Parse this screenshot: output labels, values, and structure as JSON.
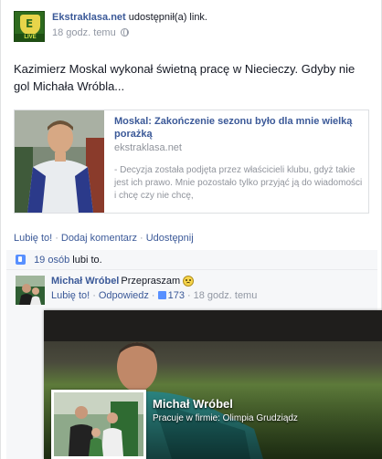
{
  "post": {
    "page_name": "Ekstraklasa.net",
    "action": "udostępnił(a) link.",
    "timestamp": "18 godz. temu",
    "logo_letter": "E",
    "logo_band": "LIVE",
    "message": "Kazimierz Moskal wykonał świetną pracę w Niecieczy. Gdyby nie gol Michała Wróbla..."
  },
  "attachment": {
    "title": "Moskal: Zakończenie sezonu było dla mnie wielką porażką",
    "source": "ekstraklasa.net",
    "description": "- Decyzja została podjęta przez właścicieli klubu, gdyż takie jest ich prawo. Mnie pozostało tylko przyjąć ją do wiadomości i chcę czy nie chcę,"
  },
  "actions": {
    "like": "Lubię to!",
    "comment": "Dodaj komentarz",
    "share": "Udostępnij"
  },
  "likes": {
    "count": "19 osób",
    "label": "lubi to."
  },
  "comment": {
    "author": "Michał Wróbel",
    "text": "Przepraszam",
    "like": "Lubię to!",
    "reply": "Odpowiedz",
    "like_count": "173",
    "timestamp": "18 godz. temu"
  },
  "hovercard": {
    "name": "Michał Wróbel",
    "work": "Pracuje w firmie: Olimpia Grudziądz"
  },
  "colors": {
    "link": "#3b5998",
    "meta": "#9197a3",
    "like_blue": "#5890ff"
  }
}
